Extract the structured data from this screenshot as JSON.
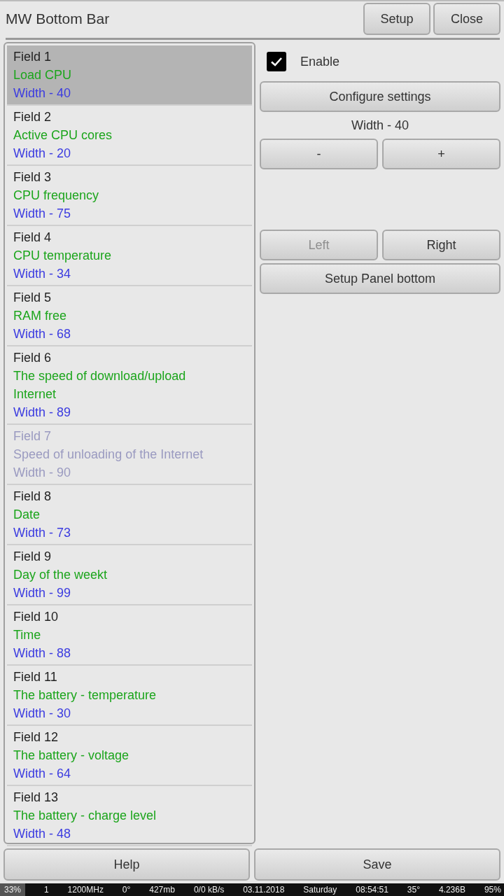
{
  "title": "MW Bottom Bar",
  "header_buttons": [
    "Setup",
    "Close"
  ],
  "fields": [
    {
      "name": "Field 1",
      "description": "Load CPU",
      "width": "Width - 40",
      "selected": true,
      "enabled": true
    },
    {
      "name": "Field 2",
      "description": "Active CPU cores",
      "width": "Width - 20",
      "selected": false,
      "enabled": true
    },
    {
      "name": "Field 3",
      "description": "CPU frequency",
      "width": "Width - 75",
      "selected": false,
      "enabled": true
    },
    {
      "name": "Field 4",
      "description": "CPU temperature",
      "width": "Width - 34",
      "selected": false,
      "enabled": true
    },
    {
      "name": "Field 5",
      "description": "RAM free",
      "width": "Width - 68",
      "selected": false,
      "enabled": true
    },
    {
      "name": "Field 6",
      "description": "The speed of download/upload Internet",
      "width": "Width - 89",
      "selected": false,
      "enabled": true
    },
    {
      "name": "Field 7",
      "description": "Speed of unloading of the Internet",
      "width": "Width - 90",
      "selected": false,
      "enabled": false
    },
    {
      "name": "Field 8",
      "description": "Date",
      "width": "Width - 73",
      "selected": false,
      "enabled": true
    },
    {
      "name": "Field 9",
      "description": "Day of the weekt",
      "width": "Width - 99",
      "selected": false,
      "enabled": true
    },
    {
      "name": "Field 10",
      "description": "Time",
      "width": "Width - 88",
      "selected": false,
      "enabled": true
    },
    {
      "name": "Field 11",
      "description": "The battery - temperature",
      "width": "Width - 30",
      "selected": false,
      "enabled": true
    },
    {
      "name": "Field 12",
      "description": "The battery - voltage",
      "width": "Width - 64",
      "selected": false,
      "enabled": true
    },
    {
      "name": "Field 13",
      "description": "The battery - charge level",
      "width": "Width - 48",
      "selected": false,
      "enabled": true
    }
  ],
  "enable": {
    "label": "Enable",
    "checked": true
  },
  "configure_button": "Configure settings",
  "width_label": "Width - 40",
  "width_buttons": [
    {
      "label": "-",
      "disabled": false
    },
    {
      "label": "+",
      "disabled": false
    }
  ],
  "position_buttons": [
    {
      "label": "Left",
      "disabled": true
    },
    {
      "label": "Right",
      "disabled": false
    }
  ],
  "setup_panel_button": "Setup Panel bottom",
  "footer_buttons": [
    "Help",
    "Save"
  ],
  "status_bar": [
    "33%",
    "1",
    "1200MHz",
    "0°",
    "427mb",
    "0/0 kB/s",
    "03.11.2018",
    "Saturday",
    "08:54:51",
    "35°",
    "4.236B",
    "95%"
  ]
}
